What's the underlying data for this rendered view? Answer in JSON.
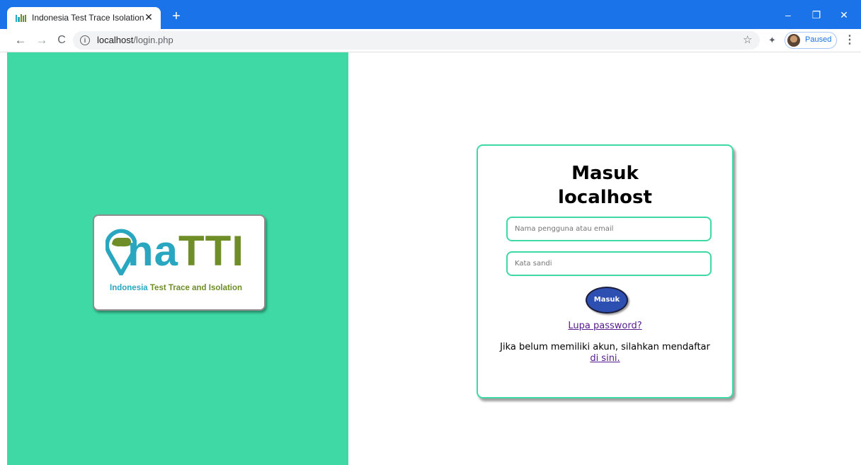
{
  "browser": {
    "tab_title": "Indonesia Test Trace Isolation",
    "new_tab_symbol": "+",
    "url_host": "localhost",
    "url_path": "/login.php",
    "profile_status": "Paused",
    "accent_color": "#1a73e8"
  },
  "logo": {
    "word_part1": "na",
    "word_part2": "TTI",
    "tagline_part1": "Indonesia",
    "tagline_part2": " Test Trace and Isolation"
  },
  "login": {
    "title_line1": "Masuk",
    "title_line2": "localhost",
    "username_placeholder": "Nama pengguna atau email",
    "password_placeholder": "Kata sandi",
    "submit_label": "Masuk",
    "forgot_label": "Lupa password?",
    "register_prompt": "Jika belum memiliki akun, silahkan mendaftar ",
    "register_link": "di sini.",
    "accent_color": "#3ed9a4",
    "button_color": "#2c4fb1"
  }
}
